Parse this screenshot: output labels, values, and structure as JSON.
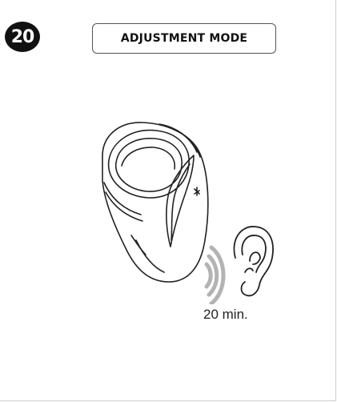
{
  "step": {
    "number": "20"
  },
  "title": {
    "label": "ADJUSTMENT MODE"
  },
  "instruction": {
    "duration_label": "20 min."
  },
  "icons": [
    "device-icon",
    "ear-icon",
    "sound-waves-icon"
  ],
  "colors": {
    "badge_bg": "#111111",
    "badge_text": "#ffffff",
    "line": "#222222",
    "wave": "#b3b3b3"
  }
}
